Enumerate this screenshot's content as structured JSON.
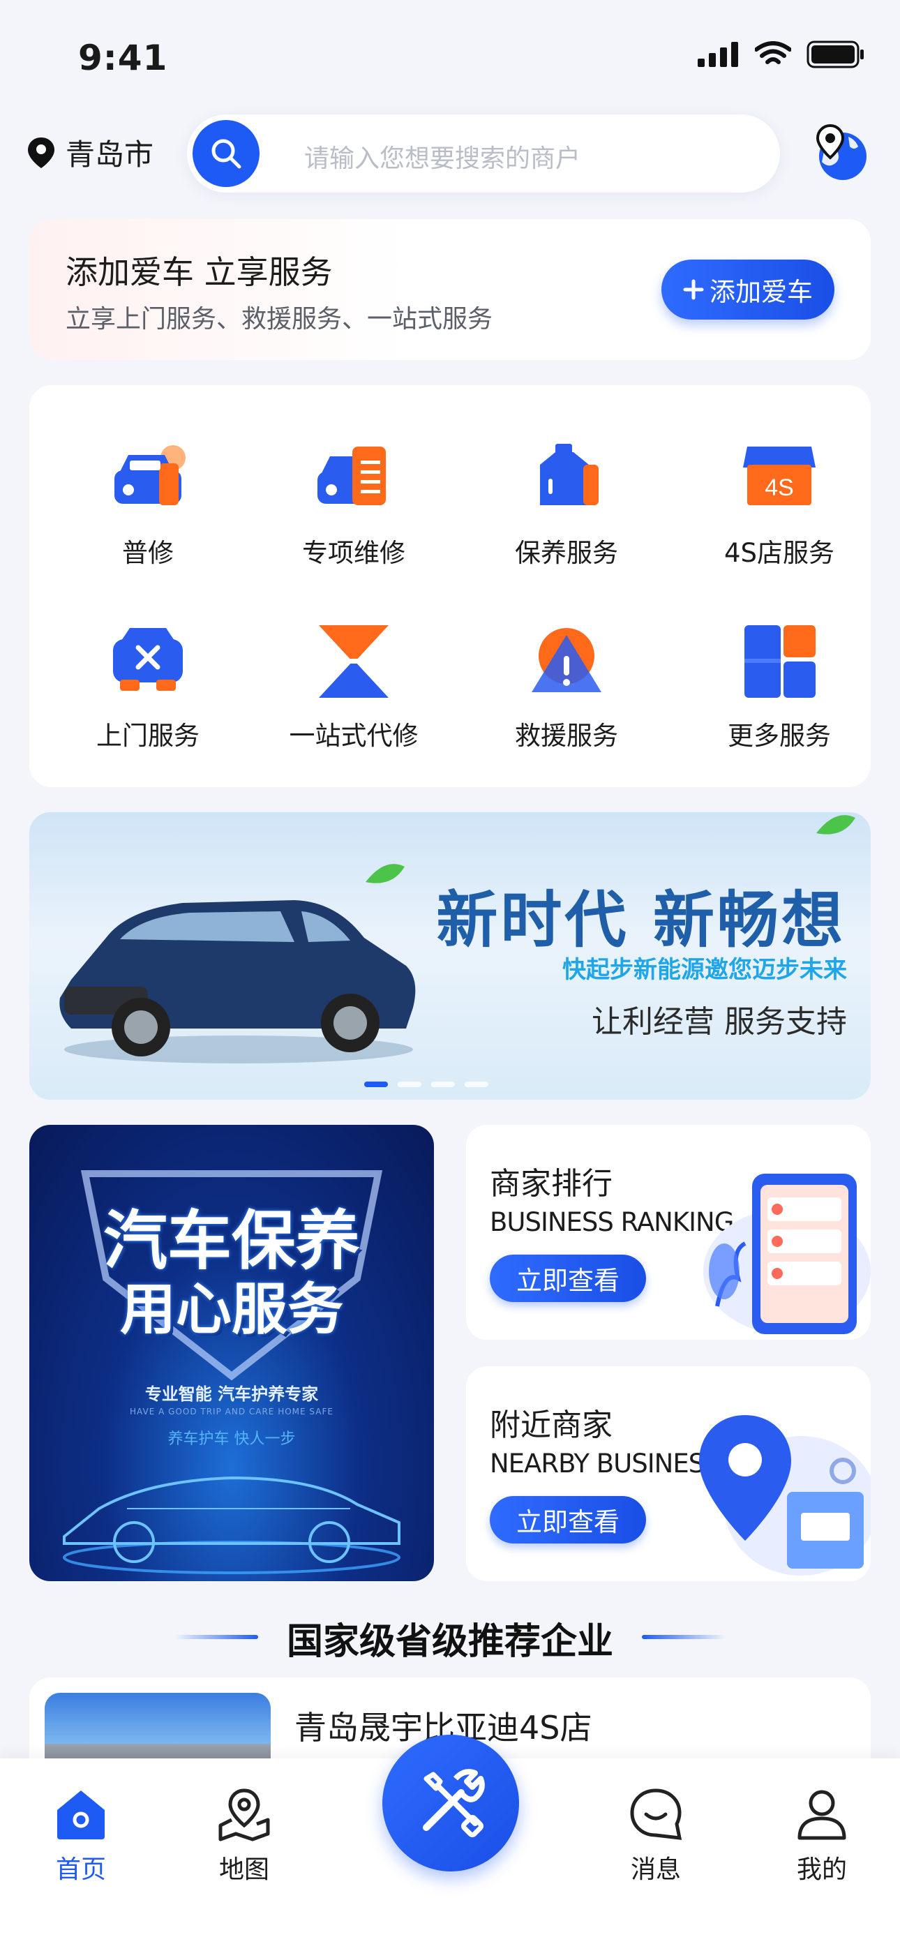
{
  "status_bar": {
    "time": "9:41"
  },
  "header": {
    "city": "青岛市",
    "search_placeholder": "请输入您想要搜索的商户"
  },
  "add_car": {
    "title": "添加爱车 立享服务",
    "subtitle": "立享上门服务、救援服务、一站式服务",
    "button": "添加爱车"
  },
  "services": [
    {
      "label": "普修",
      "icon": "car-repair-icon"
    },
    {
      "label": "专项维修",
      "icon": "special-repair-icon"
    },
    {
      "label": "保养服务",
      "icon": "oil-bottle-icon"
    },
    {
      "label": "4S店服务",
      "icon": "4s-store-icon",
      "badge": "4S"
    },
    {
      "label": "上门服务",
      "icon": "door-service-icon"
    },
    {
      "label": "一站式代修",
      "icon": "one-stop-icon"
    },
    {
      "label": "救援服务",
      "icon": "rescue-icon"
    },
    {
      "label": "更多服务",
      "icon": "more-grid-icon"
    }
  ],
  "banner": {
    "title": "新时代  新畅想",
    "subtitle": "快起步新能源邀您迈步未来",
    "subtitle2": "让利经营  服务支持",
    "slides": 4,
    "active_slide": 1
  },
  "promo": {
    "line1": "汽车保养",
    "line2": "用心服务",
    "line3": "专业智能  汽车护养专家",
    "line4": "HAVE A GOOD TRIP AND CARE HOME SAFE",
    "line5": "养车护车  快人一步"
  },
  "ranking_card": {
    "title": "商家排行",
    "subtitle": "BUSINESS RANKING",
    "button": "立即查看"
  },
  "nearby_card": {
    "title": "附近商家",
    "subtitle": "NEARBY BUSINESSES",
    "button": "立即查看"
  },
  "section": {
    "title": "国家级省级推荐企业"
  },
  "enterprise": {
    "name": "青岛晟宇比亚迪4S店"
  },
  "tabbar": {
    "items": [
      {
        "label": "首页",
        "icon": "home-icon",
        "active": true
      },
      {
        "label": "地图",
        "icon": "map-icon",
        "active": false
      },
      {
        "label": "消息",
        "icon": "message-icon",
        "active": false
      },
      {
        "label": "我的",
        "icon": "profile-icon",
        "active": false
      }
    ]
  },
  "colors": {
    "primary": "#1e5bf5",
    "accent_orange": "#ff6a1a",
    "background": "#f3f5fa"
  }
}
